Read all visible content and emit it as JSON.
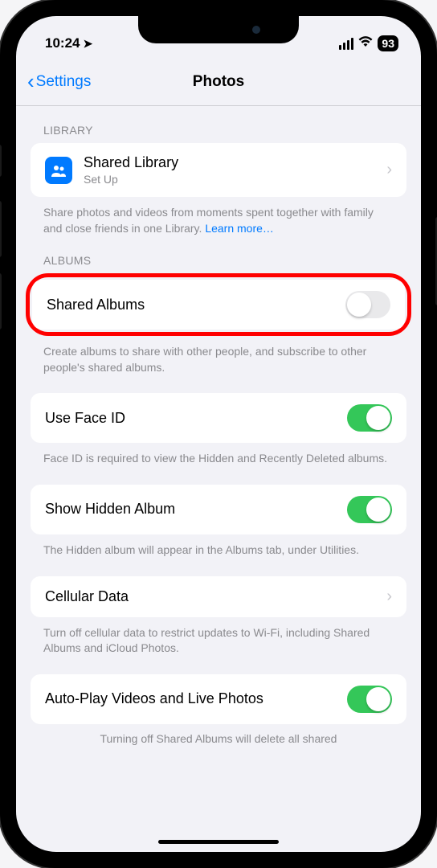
{
  "statusBar": {
    "time": "10:24",
    "battery": "93"
  },
  "nav": {
    "back": "Settings",
    "title": "Photos"
  },
  "sections": {
    "library": {
      "header": "LIBRARY",
      "sharedLibrary": {
        "title": "Shared Library",
        "subtitle": "Set Up"
      },
      "footer": "Share photos and videos from moments spent together with family and close friends in one Library.",
      "learnMore": "Learn more…"
    },
    "albums": {
      "header": "ALBUMS",
      "sharedAlbums": {
        "title": "Shared Albums",
        "enabled": false
      },
      "footer": "Create albums to share with other people, and subscribe to other people's shared albums."
    },
    "faceId": {
      "title": "Use Face ID",
      "enabled": true,
      "footer": "Face ID is required to view the Hidden and Recently Deleted albums."
    },
    "hidden": {
      "title": "Show Hidden Album",
      "enabled": true,
      "footer": "The Hidden album will appear in the Albums tab, under Utilities."
    },
    "cellular": {
      "title": "Cellular Data",
      "footer": "Turn off cellular data to restrict updates to Wi-Fi, including Shared Albums and iCloud Photos."
    },
    "autoplay": {
      "title": "Auto-Play Videos and Live Photos",
      "enabled": true,
      "footer": "Turning off Shared Albums will delete all shared"
    }
  }
}
